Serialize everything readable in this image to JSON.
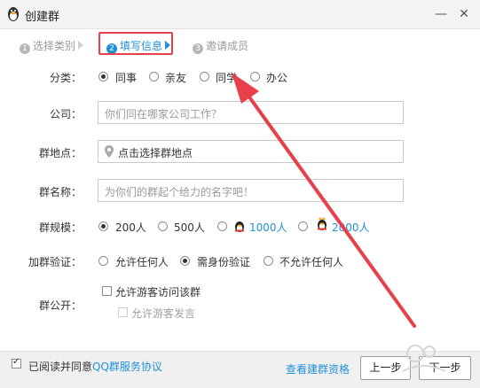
{
  "window": {
    "title": "创建群",
    "minimize_label": "—",
    "close_label": "✕"
  },
  "steps": [
    {
      "num": "1",
      "label": "选择类别"
    },
    {
      "num": "2",
      "label": "填写信息"
    },
    {
      "num": "3",
      "label": "邀请成员"
    }
  ],
  "form": {
    "category": {
      "label": "分类：",
      "options": [
        "同事",
        "亲友",
        "同学",
        "办公"
      ],
      "selected": "同事"
    },
    "company": {
      "label": "公司：",
      "placeholder": "你们同在哪家公司工作？"
    },
    "location": {
      "label": "群地点：",
      "placeholder": "点击选择群地点"
    },
    "group_name": {
      "label": "群名称：",
      "placeholder": "为你们的群起个给力的名字吧！"
    },
    "size": {
      "label": "群规模：",
      "options": [
        "200人",
        "500人",
        "1000人",
        "2000人"
      ],
      "selected": "200人"
    },
    "verify": {
      "label": "加群验证：",
      "options": [
        "允许任何人",
        "需身份验证",
        "不允许任何人"
      ],
      "selected": "需身份验证"
    },
    "public": {
      "label": "群公开：",
      "allow_visit": "允许游客访问该群",
      "allow_speak": "允许游客发言"
    }
  },
  "footer": {
    "agree_prefix": "已阅读并同意",
    "agree_link": "QQ群服务协议",
    "qualification_link": "查看建群资格",
    "prev_button": "上一步",
    "next_button": "下一步"
  },
  "colors": {
    "accent": "#1e90d8",
    "annotation": "#e8404a"
  },
  "icons": {
    "app": "qq-penguin-icon",
    "location": "map-pin-icon",
    "tier": "qq-crown-penguin-icon"
  }
}
